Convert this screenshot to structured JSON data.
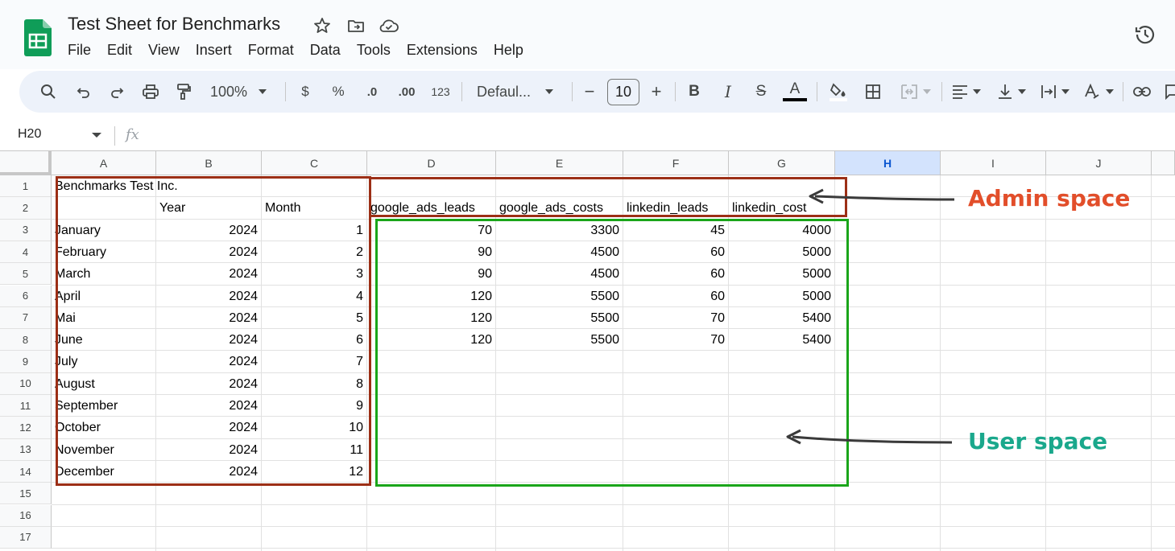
{
  "app": {
    "title": "Test Sheet for Benchmarks",
    "menus": [
      "File",
      "Edit",
      "View",
      "Insert",
      "Format",
      "Data",
      "Tools",
      "Extensions",
      "Help"
    ]
  },
  "toolbar": {
    "zoom": "100%",
    "currency": "$",
    "percent": "%",
    "dec_decrease": ".0",
    "dec_increase": ".00",
    "number_format": "123",
    "font": "Defaul...",
    "minus": "−",
    "font_size": "10",
    "plus": "+",
    "bold": "B",
    "italic": "I",
    "strike": "S",
    "text_color_glyph": "A"
  },
  "formula_bar": {
    "name_box": "H20",
    "fx": "fx",
    "content": ""
  },
  "columns": [
    "A",
    "B",
    "C",
    "D",
    "E",
    "F",
    "G",
    "H",
    "I",
    "J"
  ],
  "selected_column": "H",
  "rows": [
    "1",
    "2",
    "3",
    "4",
    "5",
    "6",
    "7",
    "8",
    "9",
    "10",
    "11",
    "12",
    "13",
    "14",
    "15",
    "16",
    "17"
  ],
  "sheet": {
    "a1": "Benchmarks Test Inc.",
    "headers": {
      "b2": "Year",
      "c2": "Month",
      "d2": "google_ads_leads",
      "e2": "google_ads_costs",
      "f2": "linkedin_leads",
      "g2": "linkedin_cost"
    },
    "data_rows": [
      [
        "January",
        "2024",
        "1",
        "70",
        "3300",
        "45",
        "4000"
      ],
      [
        "February",
        "2024",
        "2",
        "90",
        "4500",
        "60",
        "5000"
      ],
      [
        "March",
        "2024",
        "3",
        "90",
        "4500",
        "60",
        "5000"
      ],
      [
        "April",
        "2024",
        "4",
        "120",
        "5500",
        "60",
        "5000"
      ],
      [
        "Mai",
        "2024",
        "5",
        "120",
        "5500",
        "70",
        "5400"
      ],
      [
        "June",
        "2024",
        "6",
        "120",
        "5500",
        "70",
        "5400"
      ],
      [
        "July",
        "2024",
        "7",
        "",
        "",
        "",
        ""
      ],
      [
        "August",
        "2024",
        "8",
        "",
        "",
        "",
        ""
      ],
      [
        "September",
        "2024",
        "9",
        "",
        "",
        "",
        ""
      ],
      [
        "October",
        "2024",
        "10",
        "",
        "",
        "",
        ""
      ],
      [
        "November",
        "2024",
        "11",
        "",
        "",
        "",
        ""
      ],
      [
        "December",
        "2024",
        "12",
        "",
        "",
        "",
        ""
      ]
    ]
  },
  "annotations": {
    "admin_label": "Admin space",
    "user_label": "User space",
    "admin_color": "#9c2f16",
    "user_color": "#1aa51a",
    "admin_text_color": "#e24e2a",
    "user_text_color": "#1aa88c"
  }
}
